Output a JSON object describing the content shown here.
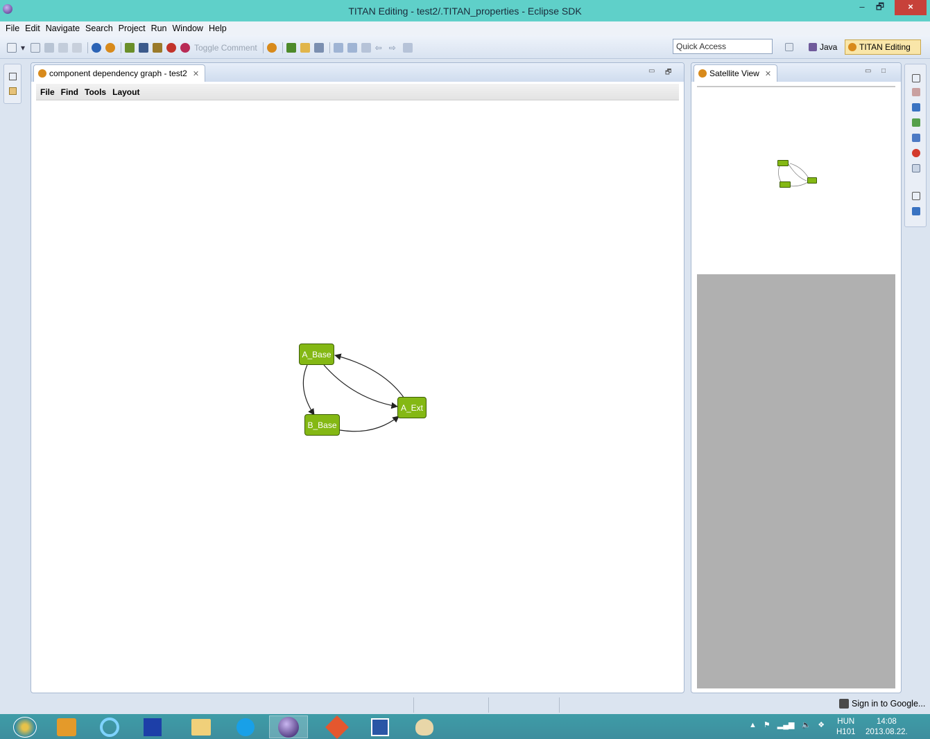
{
  "window": {
    "title": "TITAN Editing - test2/.TITAN_properties - Eclipse SDK",
    "minimize": "–",
    "maximize": "🗗",
    "close": "×"
  },
  "menu": [
    "File",
    "Edit",
    "Navigate",
    "Search",
    "Project",
    "Run",
    "Window",
    "Help"
  ],
  "toolbar": {
    "toggle_comment": "Toggle Comment",
    "quick_access": "Quick Access",
    "perspectives": [
      "Java",
      "TITAN Editing"
    ]
  },
  "editor": {
    "tab_label": "component dependency graph - test2",
    "tab_close": "✕",
    "graph_menu": [
      "File",
      "Find",
      "Tools",
      "Layout"
    ],
    "graph": {
      "nodes": [
        {
          "id": "A_Base",
          "label": "A_Base"
        },
        {
          "id": "B_Base",
          "label": "B_Base"
        },
        {
          "id": "A_Ext",
          "label": "A_Ext"
        }
      ],
      "edges": [
        {
          "from": "A_Base",
          "to": "B_Base"
        },
        {
          "from": "A_Base",
          "to": "A_Ext"
        },
        {
          "from": "B_Base",
          "to": "A_Ext"
        },
        {
          "from": "A_Ext",
          "to": "A_Base"
        }
      ]
    }
  },
  "satellite": {
    "tab_label": "Satellite View",
    "tab_close": "✕"
  },
  "status": {
    "sign_in": "Sign in to Google..."
  },
  "taskbar": {
    "language": "HUN",
    "layout": "H101",
    "time": "14:08",
    "date": "2013.08.22."
  },
  "colors": {
    "node_fill": "#84b814",
    "node_border": "#3d5e06",
    "titlebar": "#5fd0c9",
    "taskbar": "#3f9ca7",
    "close_button": "#c7413a"
  }
}
